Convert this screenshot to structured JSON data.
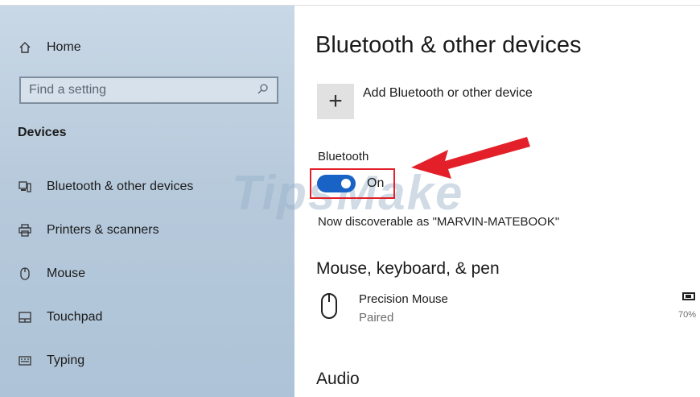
{
  "sidebar": {
    "home_label": "Home",
    "search_placeholder": "Find a setting",
    "section_heading": "Devices",
    "items": [
      {
        "label": "Bluetooth & other devices",
        "icon": "bluetooth-devices-icon"
      },
      {
        "label": "Printers & scanners",
        "icon": "printer-icon"
      },
      {
        "label": "Mouse",
        "icon": "mouse-icon"
      },
      {
        "label": "Touchpad",
        "icon": "touchpad-icon"
      },
      {
        "label": "Typing",
        "icon": "keyboard-icon"
      }
    ]
  },
  "watermark": "TipsMake",
  "main": {
    "title": "Bluetooth & other devices",
    "add_device_label": "Add Bluetooth or other device",
    "bluetooth_label": "Bluetooth",
    "toggle_state": "On",
    "discoverable_text": "Now discoverable as \"MARVIN-MATEBOOK\"",
    "section_mouse": "Mouse, keyboard, & pen",
    "device": {
      "name": "Precision Mouse",
      "status": "Paired",
      "battery": "70%"
    },
    "section_audio": "Audio"
  },
  "colors": {
    "accent": "#1a63c6",
    "annotation_red": "#e3202a"
  }
}
